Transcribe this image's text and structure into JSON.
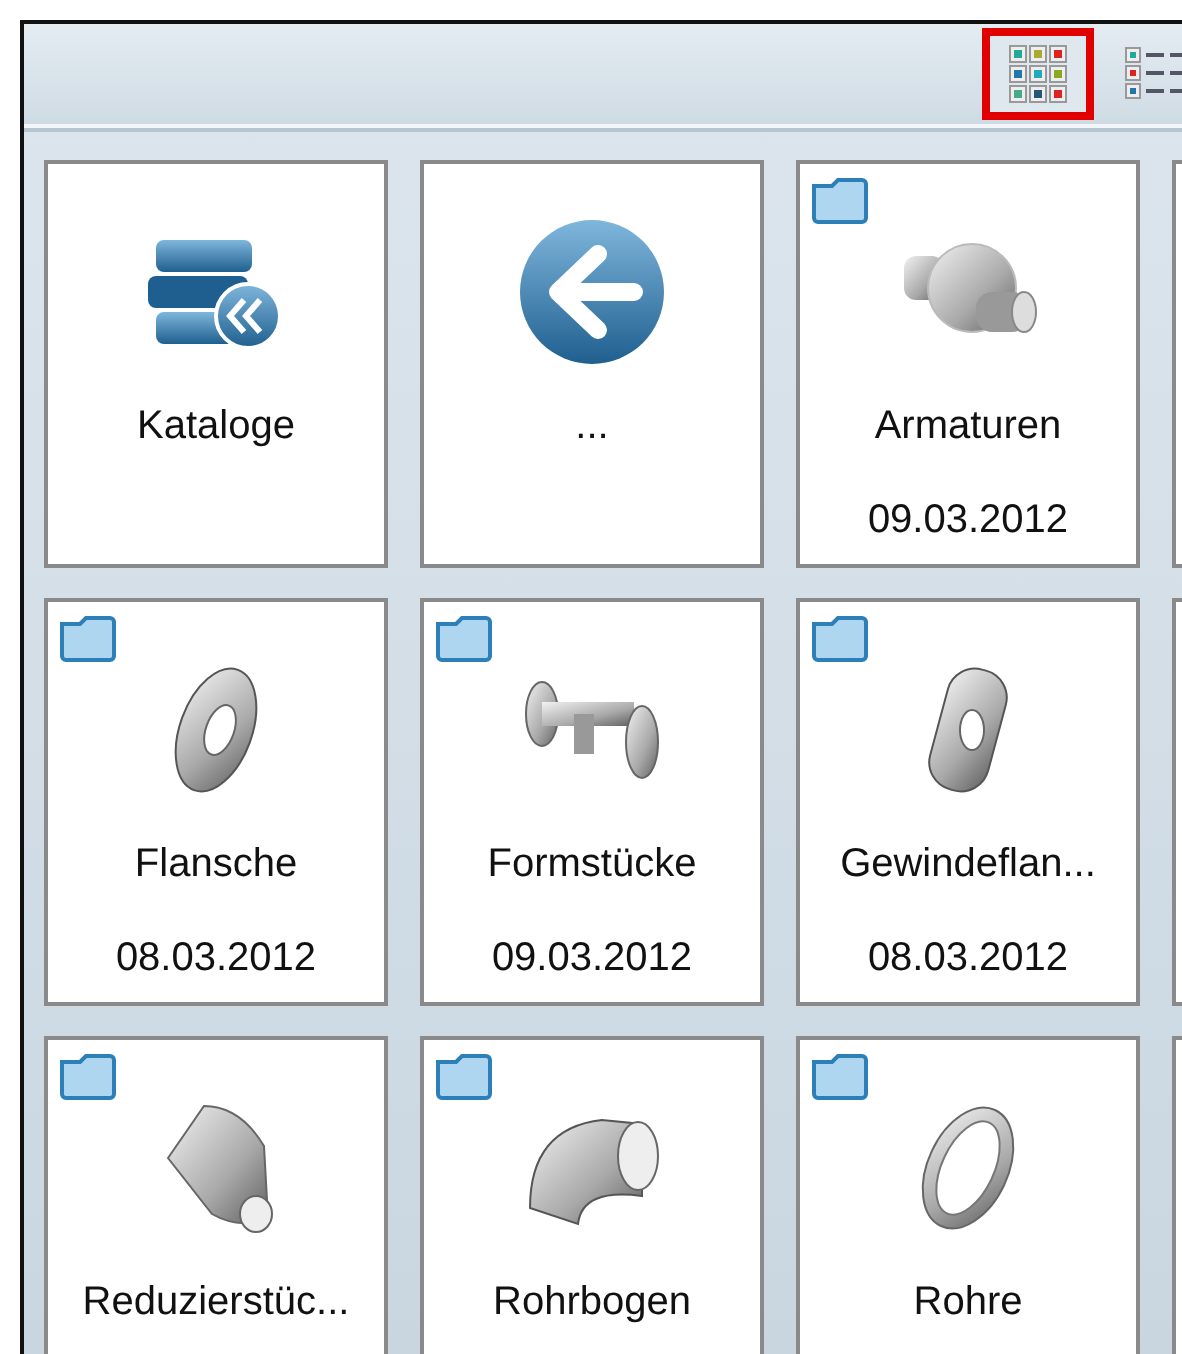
{
  "toolbar": {
    "view_buttons": [
      {
        "kind": "grid",
        "selected": true
      },
      {
        "kind": "list",
        "selected": false
      }
    ]
  },
  "tiles": [
    {
      "kind": "catalogs",
      "name": "Kataloge"
    },
    {
      "kind": "back",
      "name": "..."
    },
    {
      "kind": "folder",
      "name": "Armaturen",
      "date": "09.03.2012"
    },
    {
      "kind": "stub"
    },
    {
      "kind": "folder",
      "name": "Flansche",
      "date": "08.03.2012"
    },
    {
      "kind": "folder",
      "name": "Formstücke",
      "date": "09.03.2012"
    },
    {
      "kind": "folder",
      "name": "Gewindeflan...",
      "date": "08.03.2012"
    },
    {
      "kind": "stub"
    },
    {
      "kind": "folder",
      "name": "Reduzierstüc..."
    },
    {
      "kind": "folder",
      "name": "Rohrbogen"
    },
    {
      "kind": "folder",
      "name": "Rohre"
    },
    {
      "kind": "stub"
    }
  ]
}
